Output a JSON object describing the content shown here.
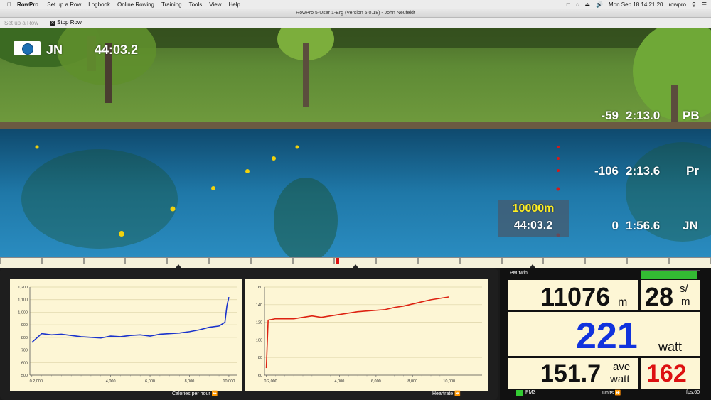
{
  "menubar": {
    "app_name": "RowPro",
    "items": [
      "Set up a Row",
      "Logbook",
      "Online Rowing",
      "Training",
      "Tools",
      "View",
      "Help"
    ],
    "datetime": "Mon Sep 18  14:21:20",
    "user": "rowpro"
  },
  "window": {
    "title": "RowPro 5-User 1-Erg (Version 5.0.18) - John Neufeldt"
  },
  "toolbar": {
    "setup_label": "Set up a Row",
    "stop_label": "Stop Row"
  },
  "hud": {
    "rower_initials": "JN",
    "elapsed_time": "44:03.2",
    "rows": [
      {
        "delta": "-59",
        "pace": "2:13.0",
        "name": "PB"
      },
      {
        "delta": "-106",
        "pace": "2:13.6",
        "name": "Pr"
      },
      {
        "delta": "0",
        "pace": "1:56.6",
        "name": "JN"
      }
    ],
    "distance_box": {
      "distance": "10000m",
      "time": "44:03.2"
    }
  },
  "colors": {
    "accent_blue": "#1133dd",
    "heart_red": "#dd1111",
    "calories_line": "#1a33cc",
    "heartrate_line": "#dd2211",
    "chart_bg": "#fdf6d5",
    "progress_green": "#33bb33"
  },
  "charts": {
    "calories_label": "Calories per hour",
    "heartrate_label": "Heartrate"
  },
  "chart_data": [
    {
      "type": "line",
      "x": [
        0,
        500,
        1000,
        1500,
        2000,
        2500,
        3000,
        3500,
        4000,
        4500,
        5000,
        5500,
        6000,
        6500,
        7000,
        7500,
        8000,
        8500,
        9000,
        9500,
        9800,
        9900,
        10000
      ],
      "series": [
        {
          "values": [
            760,
            830,
            820,
            825,
            815,
            805,
            800,
            795,
            810,
            805,
            815,
            820,
            810,
            825,
            830,
            835,
            845,
            860,
            880,
            890,
            920,
            1050,
            1120
          ]
        }
      ],
      "yticks": [
        "500",
        "600",
        "700",
        "800",
        "900",
        "1,000",
        "1,100",
        "1,200"
      ],
      "xticks": [
        "0 2,000",
        "4,000",
        "6,000",
        "8,000",
        "10,000"
      ],
      "ylim": [
        500,
        1200
      ],
      "xlim": [
        -100,
        10400
      ],
      "xlabel": "Calories per hour",
      "grid": true
    },
    {
      "type": "line",
      "x": [
        0,
        100,
        500,
        1000,
        1500,
        2000,
        2500,
        3000,
        3500,
        4000,
        4500,
        5000,
        5500,
        6000,
        6500,
        7000,
        7500,
        8000,
        8500,
        9000,
        9500,
        10000
      ],
      "series": [
        {
          "values": [
            60,
            128,
            130,
            130,
            130,
            132,
            134,
            132,
            134,
            136,
            138,
            140,
            141,
            142,
            143,
            146,
            148,
            151,
            154,
            157,
            159,
            161
          ]
        }
      ],
      "yticks": [
        "60",
        "80",
        "100",
        "120",
        "140",
        "160"
      ],
      "xticks": [
        "0 2,000",
        "4,000",
        "6,000",
        "8,000",
        "10,000"
      ],
      "ylim": [
        50,
        175
      ],
      "xlim": [
        -100,
        11800
      ],
      "xlabel": "Heartrate",
      "grid": true
    }
  ],
  "pm": {
    "title": "PM twin",
    "progress": 0.95,
    "distance_value": "11076",
    "distance_unit": "m",
    "spm_value": "28",
    "spm_unit_top": "s/",
    "spm_unit_bottom": "m",
    "watts_value": "221",
    "watts_unit": "watt",
    "avg_value": "151.7",
    "avg_unit_top": "ave",
    "avg_unit_bottom": "watt",
    "heartrate_value": "162",
    "device_label": "PM3",
    "units_label": "Units",
    "fps_label": "fps:60"
  }
}
